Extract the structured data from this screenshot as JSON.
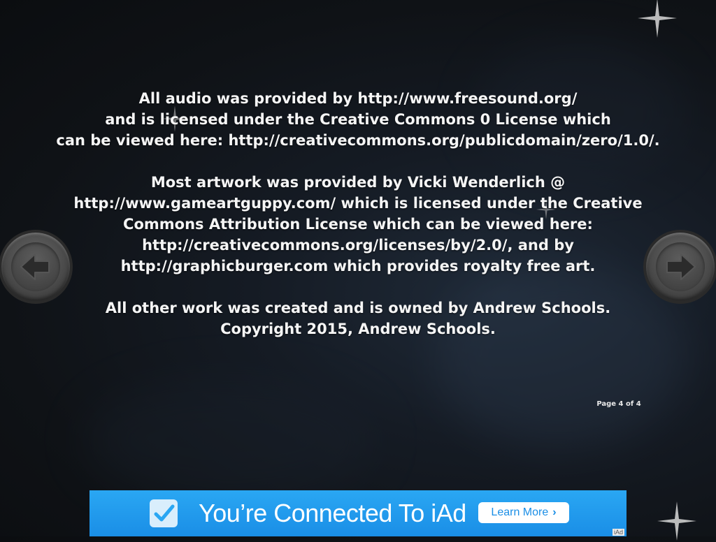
{
  "credits": {
    "paragraphs": [
      {
        "lines": [
          "All audio was provided by http://www.freesound.org/",
          "and is licensed under the Creative Commons 0 License which",
          "can be viewed here: http://creativecommons.org/publicdomain/zero/1.0/."
        ]
      },
      {
        "lines": [
          "Most artwork was provided by Vicki Wenderlich @",
          "http://www.gameartguppy.com/ which is licensed under the Creative",
          "Commons Attribution License which can be viewed here:",
          "http://creativecommons.org/licenses/by/2.0/, and by",
          "http://graphicburger.com which provides royalty free art."
        ]
      },
      {
        "lines": [
          "All other work was created and is owned by Andrew Schools.",
          "Copyright 2015, Andrew Schools."
        ]
      }
    ]
  },
  "navigation": {
    "prev_icon": "arrow-left-icon",
    "next_icon": "arrow-right-icon"
  },
  "page_indicator": "Page 4 of 4",
  "ad": {
    "check_icon": "checkmark-icon",
    "headline": "You’re Connected To iAd",
    "learn_more": "Learn More",
    "learn_more_chevron": "›",
    "corner_label": "iAd",
    "color": "#1a8ee6"
  }
}
